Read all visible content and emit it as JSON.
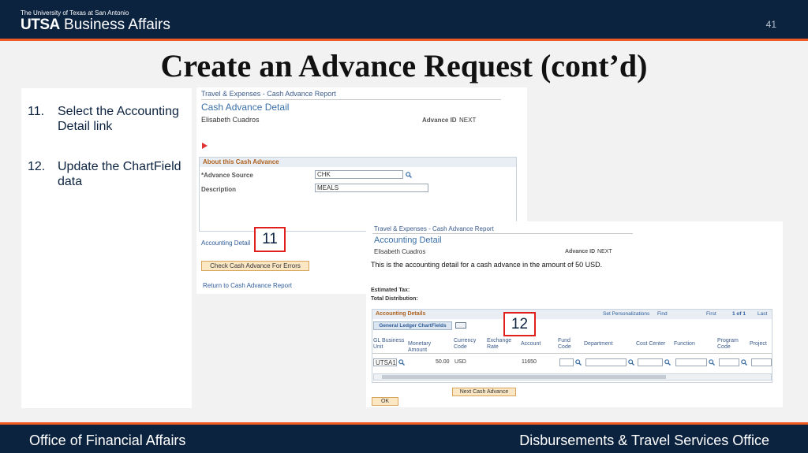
{
  "header": {
    "university": "The University of Texas at San Antonio",
    "brand_bold": "UTSA",
    "brand_rest": "Business Affairs",
    "page_number": "41"
  },
  "title": "Create an Advance Request (cont’d)",
  "steps": [
    {
      "num": "11.",
      "text": "Select the Accounting Detail link"
    },
    {
      "num": "12.",
      "text": "Update the ChartField data"
    }
  ],
  "screen1": {
    "breadcrumb": "Travel & Expenses - Cash Advance Report",
    "page_title": "Cash Advance Detail",
    "employee": "Elisabeth Cuadros",
    "advance_id_label": "Advance ID",
    "advance_id_value": "NEXT",
    "section_title": "About this Cash Advance",
    "source_label": "*Advance Source",
    "source_value": "CHK",
    "description_label": "Description",
    "description_value": "MEALS",
    "accounting_link": "Accounting Detail",
    "check_button": "Check Cash Advance For Errors",
    "return_link": "Return to Cash Advance Report"
  },
  "screen2": {
    "breadcrumb": "Travel & Expenses - Cash Advance Report",
    "page_title": "Accounting Detail",
    "employee": "Elisabeth Cuadros",
    "advance_id_label": "Advance ID",
    "advance_id_value": "NEXT",
    "info_text": "This is the accounting detail for a cash advance in the amount of 50 USD.",
    "estimated_tax": "Estimated Tax:",
    "total_distribution": "Total Distribution:",
    "grid_title": "Accounting Details",
    "personalize": "Set Personalizations",
    "find": "Find",
    "first": "First",
    "page_info": "1 of 1",
    "last": "Last",
    "tab_label": "General Ledger ChartFields",
    "columns": [
      "GL Business Unit",
      "Monetary Amount",
      "Currency Code",
      "Exchange Rate",
      "Account",
      "Fund Code",
      "Department",
      "Cost Center",
      "Function",
      "Program Code",
      "Project"
    ],
    "row": {
      "business_unit": "UTSA1",
      "amount": "50.00",
      "currency": "USD",
      "account": "11650"
    },
    "next_button": "Next Cash Advance",
    "ok_button": "OK"
  },
  "callouts": {
    "first": "11",
    "second": "12"
  },
  "footer": {
    "left": "Office of Financial Affairs",
    "right": "Disbursements & Travel Services Office"
  },
  "colors": {
    "navy": "#0c2340",
    "orange": "#f15a22",
    "callout_red": "#e0201c"
  }
}
